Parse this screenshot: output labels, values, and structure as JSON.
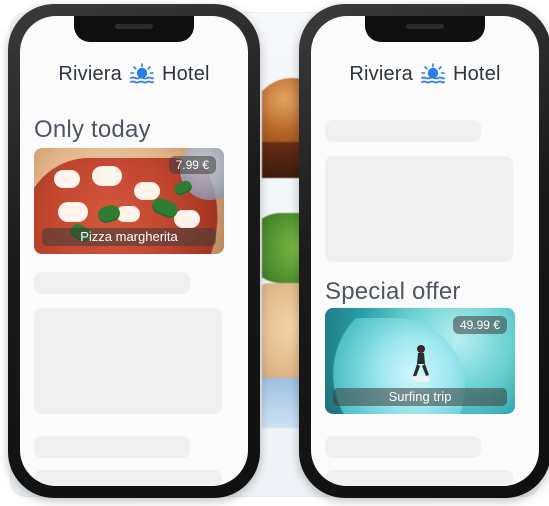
{
  "brand": {
    "name_left": "Riviera",
    "name_right": "Hotel",
    "logo_icon": "sun-over-waves-icon"
  },
  "left_phone": {
    "section_title": "Only today",
    "card": {
      "price": "7.99 €",
      "label": "Pizza margherita",
      "image": "pizza-image"
    }
  },
  "right_phone": {
    "section_title": "Special offer",
    "card": {
      "price": "49.99 €",
      "label": "Surfing trip",
      "image": "surfing-image"
    }
  },
  "colors": {
    "phone_frame": "#111111",
    "screen_bg": "#fbfbfb",
    "skeleton": "#f0f0f0",
    "text": "#2e3440",
    "logo_blue": "#2b7de9"
  }
}
